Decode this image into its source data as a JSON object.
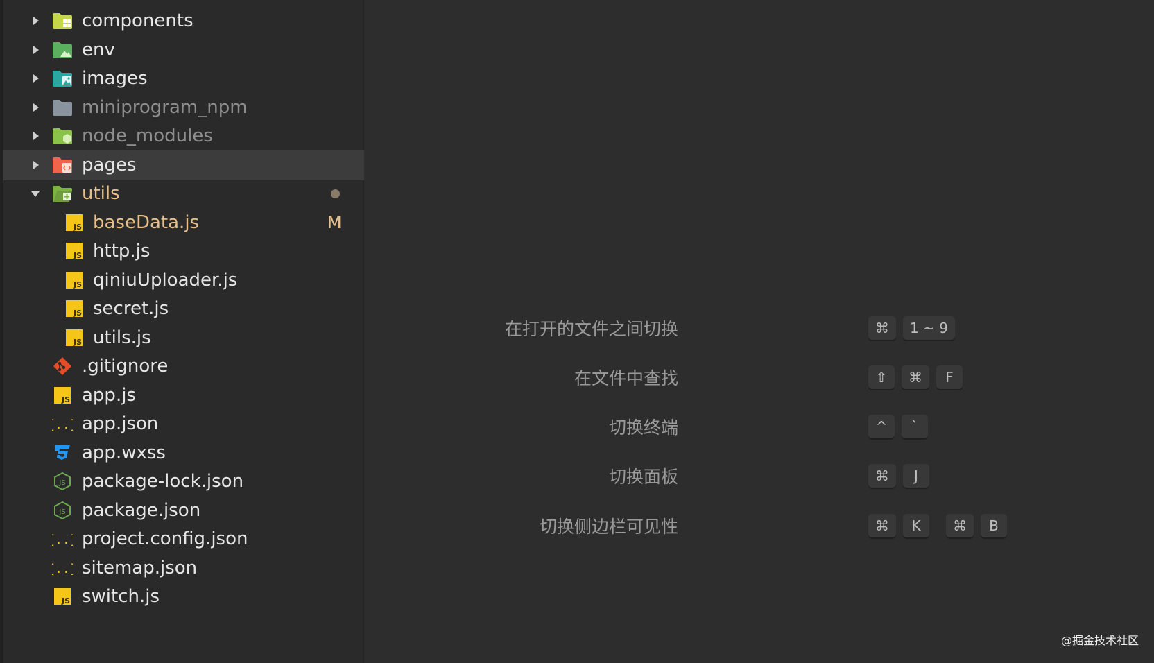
{
  "explorer": {
    "items": [
      {
        "label": "components",
        "kind": "folder-components",
        "level": 0,
        "expanded": false,
        "dim": false,
        "icon": "components-folder-icon",
        "color": "#c6d64b"
      },
      {
        "label": "env",
        "kind": "folder-env",
        "level": 0,
        "expanded": false,
        "dim": false,
        "icon": "env-folder-icon",
        "color": "#5bb05f"
      },
      {
        "label": "images",
        "kind": "folder-images",
        "level": 0,
        "expanded": false,
        "dim": false,
        "icon": "images-folder-icon",
        "color": "#2aa7a0"
      },
      {
        "label": "miniprogram_npm",
        "kind": "folder-plain",
        "level": 0,
        "expanded": false,
        "dim": true,
        "icon": "folder-icon",
        "color": "#8a949e"
      },
      {
        "label": "node_modules",
        "kind": "folder-node",
        "level": 0,
        "expanded": false,
        "dim": true,
        "icon": "node-modules-folder-icon",
        "color": "#8bc34a"
      },
      {
        "label": "pages",
        "kind": "folder-pages",
        "level": 0,
        "expanded": false,
        "dim": false,
        "selected": true,
        "icon": "pages-folder-icon",
        "color": "#f0644b"
      },
      {
        "label": "utils",
        "kind": "folder-utils",
        "level": 0,
        "expanded": true,
        "dim": false,
        "modified": true,
        "git_dot": true,
        "icon": "utils-folder-icon",
        "color": "#7cb342"
      },
      {
        "label": "baseData.js",
        "kind": "js",
        "level": 1,
        "modified": true,
        "git_status": "M",
        "icon": "js-file-icon",
        "color": "#f5c518"
      },
      {
        "label": "http.js",
        "kind": "js",
        "level": 1,
        "icon": "js-file-icon",
        "color": "#f5c518"
      },
      {
        "label": "qiniuUploader.js",
        "kind": "js",
        "level": 1,
        "icon": "js-file-icon",
        "color": "#f5c518"
      },
      {
        "label": "secret.js",
        "kind": "js",
        "level": 1,
        "icon": "js-file-icon",
        "color": "#f5c518"
      },
      {
        "label": "utils.js",
        "kind": "js",
        "level": 1,
        "icon": "js-file-icon",
        "color": "#f5c518"
      },
      {
        "label": ".gitignore",
        "kind": "git",
        "level": 0,
        "icon": "git-icon",
        "color": "#e44d26"
      },
      {
        "label": "app.js",
        "kind": "js",
        "level": 0,
        "icon": "js-file-icon",
        "color": "#f5c518"
      },
      {
        "label": "app.json",
        "kind": "json",
        "level": 0,
        "icon": "json-braces-icon",
        "color": "#f5c518"
      },
      {
        "label": "app.wxss",
        "kind": "css",
        "level": 0,
        "icon": "css-file-icon",
        "color": "#2196f3"
      },
      {
        "label": "package-lock.json",
        "kind": "node",
        "level": 0,
        "icon": "nodejs-icon",
        "color": "#6aa84f"
      },
      {
        "label": "package.json",
        "kind": "node",
        "level": 0,
        "icon": "nodejs-icon",
        "color": "#6aa84f"
      },
      {
        "label": "project.config.json",
        "kind": "json",
        "level": 0,
        "icon": "json-braces-icon",
        "color": "#f5c518"
      },
      {
        "label": "sitemap.json",
        "kind": "json",
        "level": 0,
        "icon": "json-braces-icon",
        "color": "#f5c518"
      },
      {
        "label": "switch.js",
        "kind": "js",
        "level": 0,
        "icon": "js-file-icon",
        "color": "#f5c518"
      }
    ]
  },
  "shortcuts": [
    {
      "label": "在打开的文件之间切换",
      "keys": [
        "⌘",
        "1 ~ 9"
      ]
    },
    {
      "label": "在文件中查找",
      "keys": [
        "⇧",
        "⌘",
        "F"
      ]
    },
    {
      "label": "切换终端",
      "keys": [
        "^",
        "`"
      ]
    },
    {
      "label": "切换面板",
      "keys": [
        "⌘",
        "J"
      ]
    },
    {
      "label": "切换侧边栏可见性",
      "keys": [
        "⌘",
        "K"
      ],
      "keys2": [
        "⌘",
        "B"
      ]
    }
  ],
  "watermark": "@掘金技术社区"
}
